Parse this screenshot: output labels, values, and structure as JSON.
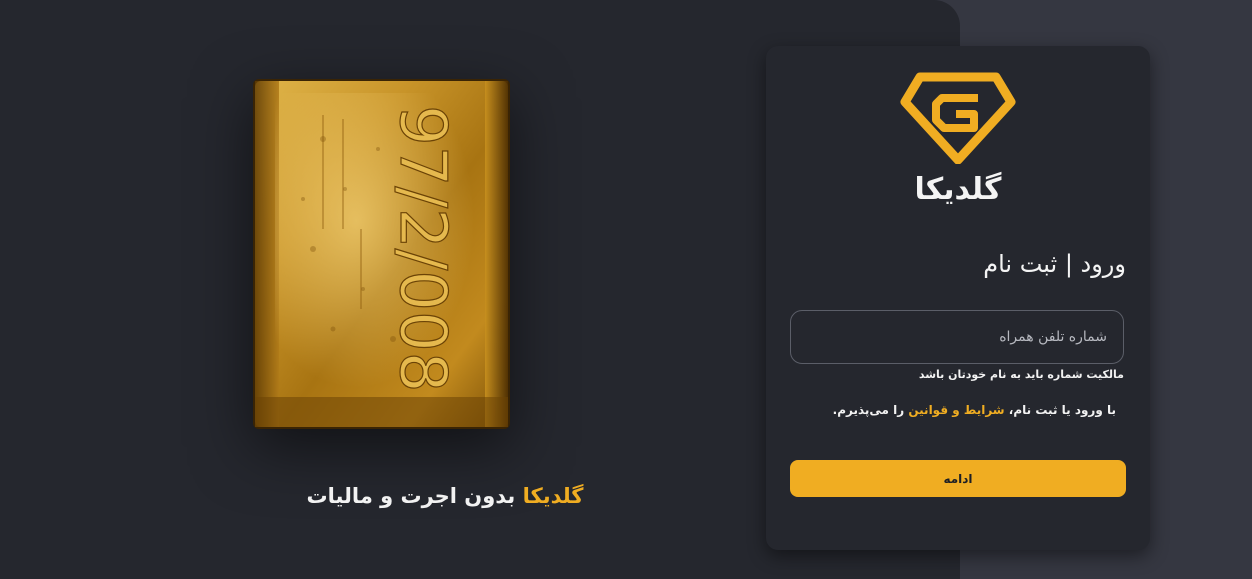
{
  "colors": {
    "page_background": "#353741",
    "panel_background": "#25272e",
    "accent": "#f0ad22",
    "text": "#f4f4f4"
  },
  "hero": {
    "image": "gold-bar",
    "bar_engraving": "97/2/008",
    "tagline_brand": "گلدیکا",
    "tagline_rest": "بدون اجرت و مالیات"
  },
  "login_card": {
    "logo_icon": "diamond-g-logo-icon",
    "logo_text": "گلدیکا",
    "title": "ورود | ثبت نام",
    "phone_field": {
      "placeholder": "شماره تلفن همراه",
      "value": ""
    },
    "ownership_hint": "مالکیت شماره باید به نام خودتان باشد",
    "terms": {
      "prefix": "با ورود یا ثبت نام،",
      "link": "شرایط و قوانین",
      "suffix": "را می‌پذیرم."
    },
    "continue_label": "ادامه"
  }
}
